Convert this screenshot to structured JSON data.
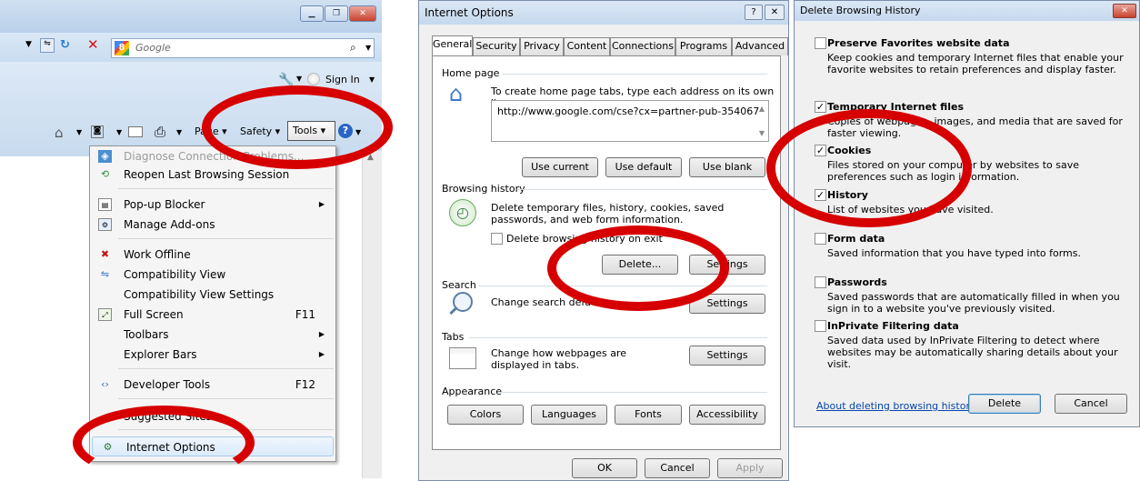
{
  "ie": {
    "search_placeholder": "Google",
    "sign_in": "Sign In",
    "cmdbar": {
      "page": "Page",
      "safety": "Safety",
      "tools": "Tools"
    },
    "menu": [
      {
        "label": "Diagnose Connection Problems...",
        "icon": "diagnose-icon",
        "disabled": true
      },
      {
        "label": "Reopen Last Browsing Session",
        "icon": "reopen-icon"
      },
      {
        "label": "Pop-up Blocker",
        "icon": "popup-icon",
        "submenu": true
      },
      {
        "label": "Manage Add-ons",
        "icon": "addons-icon"
      },
      {
        "label": "Work Offline",
        "icon": "offline-icon"
      },
      {
        "label": "Compatibility View",
        "icon": "compat-icon"
      },
      {
        "label": "Compatibility View Settings",
        "icon": ""
      },
      {
        "label": "Full Screen",
        "icon": "fullscreen-icon",
        "shortcut": "F11"
      },
      {
        "label": "Toolbars",
        "icon": "",
        "submenu": true
      },
      {
        "label": "Explorer Bars",
        "icon": "",
        "submenu": true
      },
      {
        "label": "Developer Tools",
        "icon": "devtools-icon",
        "shortcut": "F12"
      },
      {
        "label": "Suggested Sites",
        "icon": ""
      },
      {
        "label": "Internet Options",
        "icon": "options-icon"
      }
    ]
  },
  "internet_options": {
    "title": "Internet Options",
    "tabs": [
      "General",
      "Security",
      "Privacy",
      "Content",
      "Connections",
      "Programs",
      "Advanced"
    ],
    "home": {
      "group": "Home page",
      "text": "To create home page tabs, type each address on its own line.",
      "url": "http://www.google.com/cse?cx=partner-pub-354067",
      "btn_current": "Use current",
      "btn_default": "Use default",
      "btn_blank": "Use blank"
    },
    "history": {
      "group": "Browsing history",
      "text": "Delete temporary files, history, cookies, saved passwords, and web form information.",
      "checkbox": "Delete browsing history on exit",
      "btn_delete": "Delete...",
      "btn_settings": "Settings"
    },
    "search": {
      "group": "Search",
      "text": "Change search defaults.",
      "btn": "Settings"
    },
    "tabs_grp": {
      "group": "Tabs",
      "text": "Change how webpages are displayed in tabs.",
      "btn": "Settings"
    },
    "appearance": {
      "group": "Appearance",
      "colors": "Colors",
      "languages": "Languages",
      "fonts": "Fonts",
      "accessibility": "Accessibility"
    },
    "ok": "OK",
    "cancel": "Cancel",
    "apply": "Apply"
  },
  "delete_history": {
    "title": "Delete Browsing History",
    "options": [
      {
        "title": "Preserve Favorites website data",
        "desc": "Keep cookies and temporary Internet files that enable your favorite websites to retain preferences and display faster.",
        "checked": false
      },
      {
        "title": "Temporary Internet files",
        "desc": "Copies of webpages, images, and media that are saved for faster viewing.",
        "checked": true
      },
      {
        "title": "Cookies",
        "desc": "Files stored on your computer by websites to save preferences such as login information.",
        "checked": true
      },
      {
        "title": "History",
        "desc": "List of websites you have visited.",
        "checked": true
      },
      {
        "title": "Form data",
        "desc": "Saved information that you have typed into forms.",
        "checked": false
      },
      {
        "title": "Passwords",
        "desc": "Saved passwords that are automatically filled in when you sign in to a website you've previously visited.",
        "checked": false
      },
      {
        "title": "InPrivate Filtering data",
        "desc": "Saved data used by InPrivate Filtering to detect where websites may be automatically sharing details about your visit.",
        "checked": false
      }
    ],
    "link": "About deleting browsing history",
    "delete": "Delete",
    "cancel": "Cancel"
  },
  "colors": {
    "highlight_ring": "#d60000",
    "link": "#0645ad"
  }
}
